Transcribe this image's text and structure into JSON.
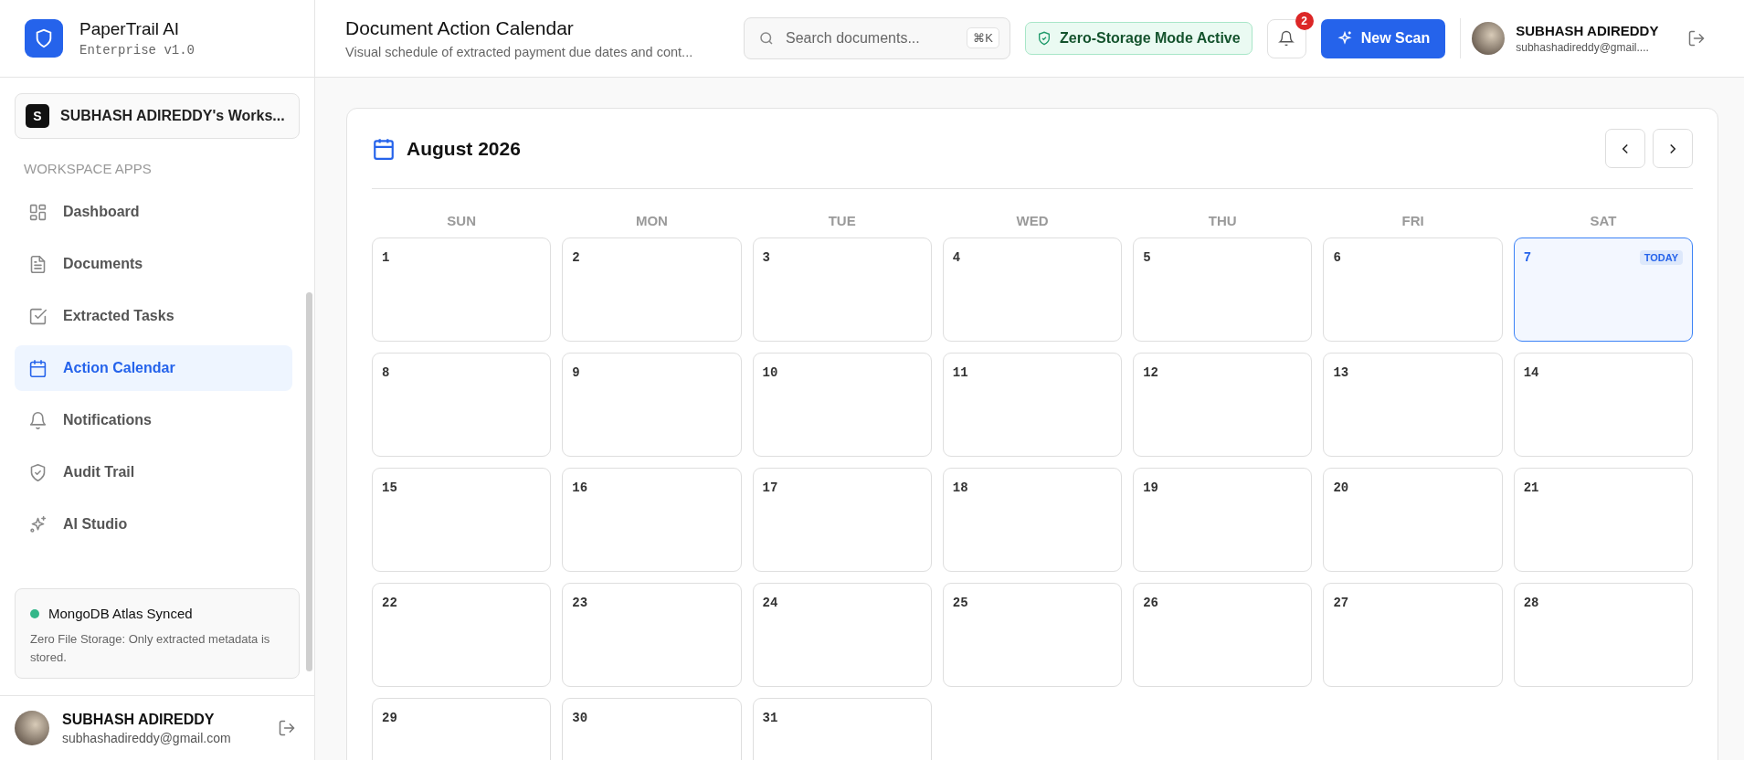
{
  "sidebar": {
    "brand": {
      "name": "PaperTrail AI",
      "edition": "Enterprise v1.0"
    },
    "workspace": {
      "initial": "S",
      "name": "SUBHASH ADIREDDY's Works..."
    },
    "section_title": "WORKSPACE APPS",
    "items": [
      {
        "label": "Dashboard",
        "selected": false
      },
      {
        "label": "Documents",
        "selected": false
      },
      {
        "label": "Extracted Tasks",
        "selected": false
      },
      {
        "label": "Action Calendar",
        "selected": true
      },
      {
        "label": "Notifications",
        "selected": false
      },
      {
        "label": "Audit Trail",
        "selected": false
      },
      {
        "label": "AI Studio",
        "selected": false
      }
    ],
    "status": {
      "title": "MongoDB Atlas Synced",
      "color": "#34b789",
      "note": "Zero File Storage: Only extracted metadata is stored."
    },
    "user": {
      "name": "SUBHASH ADIREDDY",
      "email": "subhashadireddy@gmail.com"
    }
  },
  "header": {
    "title": "Document Action Calendar",
    "subtitle": "Visual schedule of extracted payment due dates and cont...",
    "search": {
      "placeholder": "Search documents...",
      "shortcut": "⌘K"
    },
    "mode_badge": "Zero-Storage Mode Active",
    "notification_count": "2",
    "new_scan": "New Scan",
    "user": {
      "name": "SUBHASH ADIREDDY",
      "email": "subhashadireddy@gmail...."
    }
  },
  "calendar": {
    "month": "August 2026",
    "today_label": "TODAY",
    "weekdays": [
      "SUN",
      "MON",
      "TUE",
      "WED",
      "THU",
      "FRI",
      "SAT"
    ],
    "days": [
      {
        "label": "1",
        "today": false
      },
      {
        "label": "2",
        "today": false
      },
      {
        "label": "3",
        "today": false
      },
      {
        "label": "4",
        "today": false
      },
      {
        "label": "5",
        "today": false
      },
      {
        "label": "6",
        "today": false
      },
      {
        "label": "7",
        "today": true
      },
      {
        "label": "8",
        "today": false
      },
      {
        "label": "9",
        "today": false
      },
      {
        "label": "10",
        "today": false
      },
      {
        "label": "11",
        "today": false
      },
      {
        "label": "12",
        "today": false
      },
      {
        "label": "13",
        "today": false
      },
      {
        "label": "14",
        "today": false
      },
      {
        "label": "15",
        "today": false
      },
      {
        "label": "16",
        "today": false
      },
      {
        "label": "17",
        "today": false
      },
      {
        "label": "18",
        "today": false
      },
      {
        "label": "19",
        "today": false
      },
      {
        "label": "20",
        "today": false
      },
      {
        "label": "21",
        "today": false
      },
      {
        "label": "22",
        "today": false
      },
      {
        "label": "23",
        "today": false
      },
      {
        "label": "24",
        "today": false
      },
      {
        "label": "25",
        "today": false
      },
      {
        "label": "26",
        "today": false
      },
      {
        "label": "27",
        "today": false
      },
      {
        "label": "28",
        "today": false
      },
      {
        "label": "29",
        "today": false
      },
      {
        "label": "30",
        "today": false
      },
      {
        "label": "31",
        "today": false
      }
    ]
  }
}
